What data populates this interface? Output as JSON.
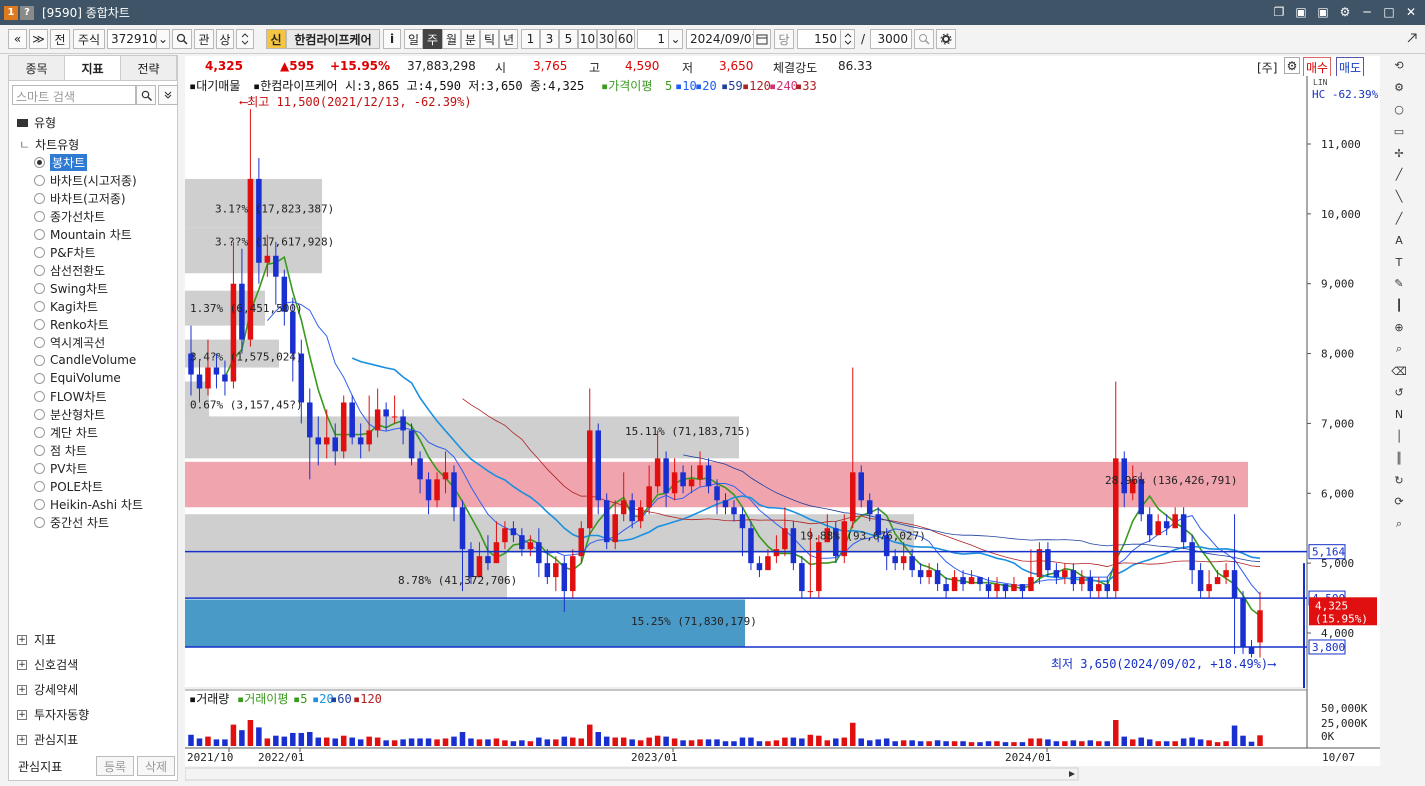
{
  "window": {
    "badges": [
      "1",
      "?"
    ],
    "title": "[9590] 종합차트",
    "controls": [
      "❐",
      "▣",
      "⚙",
      "─",
      "□",
      "✕"
    ]
  },
  "toolbar": {
    "nav_prev": "«",
    "nav_down": "≫",
    "jeon": "전",
    "market": "주식",
    "code": "372910",
    "dropdown": "⌄",
    "search_icon": "search-icon",
    "gwan": "관",
    "sang": "상",
    "shin": "신",
    "stock_name": "한컴라이프케어",
    "info": "i",
    "periods": [
      "일",
      "주",
      "월",
      "분",
      "틱",
      "년"
    ],
    "active_period": "주",
    "intervals": [
      "1",
      "3",
      "5",
      "10",
      "30",
      "60"
    ],
    "interval_value": "1",
    "date": "2024/09/07",
    "dang": "당",
    "count": "150",
    "slash": "/",
    "total": "3000"
  },
  "left": {
    "tabs": [
      "종목",
      "지표",
      "전략"
    ],
    "active_tab": "지표",
    "search_placeholder": "스마트 검색",
    "category": "유형",
    "group": "차트유형",
    "chart_types": [
      "봉차트",
      "바차트(시고저종)",
      "바차트(고저종)",
      "종가선차트",
      "Mountain 차트",
      "P&F차트",
      "삼선전환도",
      "Swing차트",
      "Kagi차트",
      "Renko차트",
      "역시계곡선",
      "CandleVolume",
      "EquiVolume",
      "FLOW차트",
      "분산형차트",
      "계단 차트",
      "점 차트",
      "PV차트",
      "POLE차트",
      "Heikin-Ashi 차트",
      "중간선 차트"
    ],
    "selected_type": "봉차트",
    "groups": [
      "지표",
      "신호검색",
      "강세약세",
      "투자자동향",
      "관심지표"
    ],
    "footer_label": "관심지표",
    "footer_register": "등록",
    "footer_delete": "삭제"
  },
  "quote": {
    "price": "4,325",
    "change": "▲595",
    "rate": "+15.95%",
    "volume": "37,883,298",
    "open_label": "시",
    "open": "3,765",
    "high_label": "고",
    "high": "4,590",
    "low_label": "저",
    "low": "3,650",
    "strength_label": "체결강도",
    "strength": "86.33",
    "mode": "[주]",
    "buy": "매수",
    "sell": "매도"
  },
  "legend": {
    "vp": "대기매물",
    "name": "한컴라이프케어",
    "ohlc": "시:3,865 고:4,590 저:3,650 종:4,325",
    "ma_label": "가격이평",
    "ma_periods": [
      "5",
      "10",
      "20",
      "59",
      "120",
      "240",
      "33"
    ],
    "ma_colors": [
      "#3a9a1e",
      "#1e5ef0",
      "#1e5ef0",
      "#1e3f9e",
      "#b02020",
      "#d03070",
      "#b02020"
    ],
    "hc": "HC -62.39%",
    "scale_tag": "LIN"
  },
  "annotations": {
    "high": "⟵최고 11,500(2021/12/13, -62.39%)",
    "low": "최저 3,650(2024/09/02, +18.49%)⟶"
  },
  "volume_profile": [
    {
      "label": "3.1?% (17,823,387)"
    },
    {
      "label": "3.??% (17,617,928)"
    },
    {
      "label": "1.37% (6,451,500)"
    },
    {
      "label": "3.4?% (1,575,024)"
    },
    {
      "label": "0.67% (3,157,45?)"
    },
    {
      "label": "15.11% (71,183,715)"
    },
    {
      "label": "28.96% (136,426,791)"
    },
    {
      "label": "19.88% (93,676,027)"
    },
    {
      "label": "8.78% (41,372,706)"
    },
    {
      "label": "15.25% (71,830,179)"
    }
  ],
  "hlines": [
    {
      "value": 5164,
      "label": "5,164"
    },
    {
      "value": 4500,
      "label": "4,500"
    },
    {
      "value": 3800,
      "label": "3,800"
    }
  ],
  "current_tag": {
    "price": "4,325",
    "rate": "(15.95%)"
  },
  "y_ticks": [
    "11,000",
    "10,000",
    "9,000",
    "8,000",
    "7,000",
    "6,000",
    "5,000",
    "4,000"
  ],
  "x_ticks": [
    "2021/10",
    "2022/01",
    "2023/01",
    "2024/01"
  ],
  "x_right_label": "10/07",
  "volume_legend": {
    "title": "거래량",
    "ma_label": "거래이평",
    "periods": [
      "5",
      "20",
      "60",
      "120"
    ]
  },
  "volume_ticks": [
    "50,000K",
    "25,000K",
    "0K"
  ],
  "chart_data": {
    "type": "candlestick",
    "y_range": [
      3000,
      12000
    ],
    "x_labels": [
      "2021/10",
      "2022/01",
      "2023/01",
      "2024/01"
    ],
    "candles": [
      [
        8000,
        7700,
        8400,
        7400
      ],
      [
        7700,
        7500,
        7900,
        7300
      ],
      [
        7500,
        7800,
        8200,
        7400
      ],
      [
        7800,
        7700,
        8000,
        7500
      ],
      [
        7700,
        7600,
        7900,
        7400
      ],
      [
        7600,
        9000,
        9600,
        7500
      ],
      [
        9000,
        8200,
        9500,
        8000
      ],
      [
        8200,
        10500,
        11500,
        8100
      ],
      [
        10500,
        9300,
        10800,
        9000
      ],
      [
        9300,
        9400,
        9700,
        9100
      ],
      [
        9400,
        9100,
        9600,
        8700
      ],
      [
        9100,
        8600,
        9200,
        8400
      ],
      [
        8600,
        8000,
        8800,
        7600
      ],
      [
        8000,
        7300,
        8200,
        7000
      ],
      [
        7300,
        6800,
        7500,
        6200
      ],
      [
        6800,
        6700,
        7100,
        6400
      ],
      [
        6700,
        6800,
        7200,
        6500
      ],
      [
        6800,
        6600,
        7000,
        6400
      ],
      [
        6600,
        7300,
        7400,
        6500
      ],
      [
        7300,
        6800,
        7400,
        6700
      ],
      [
        6800,
        6700,
        7000,
        6500
      ],
      [
        6700,
        6900,
        7400,
        6600
      ],
      [
        6900,
        7200,
        7500,
        6800
      ],
      [
        7200,
        7100,
        7300,
        6900
      ],
      [
        7100,
        7100,
        7400,
        7000
      ],
      [
        7100,
        6900,
        7200,
        6700
      ],
      [
        6900,
        6500,
        7000,
        6400
      ],
      [
        6500,
        6200,
        6600,
        6000
      ],
      [
        6200,
        5900,
        6300,
        5700
      ],
      [
        5900,
        6200,
        6300,
        5800
      ],
      [
        6200,
        6300,
        6600,
        6000
      ],
      [
        6300,
        5800,
        6400,
        5600
      ],
      [
        5800,
        5200,
        5900,
        4600
      ],
      [
        5200,
        4800,
        5300,
        4700
      ],
      [
        4800,
        5100,
        5300,
        4800
      ],
      [
        5100,
        5000,
        5400,
        4900
      ],
      [
        5000,
        5300,
        5600,
        5000
      ],
      [
        5300,
        5500,
        5600,
        5200
      ],
      [
        5500,
        5400,
        5600,
        5300
      ],
      [
        5400,
        5200,
        5500,
        5100
      ],
      [
        5200,
        5300,
        5400,
        5100
      ],
      [
        5300,
        5000,
        5500,
        4800
      ],
      [
        5000,
        4800,
        5200,
        4700
      ],
      [
        4800,
        5000,
        5100,
        4600
      ],
      [
        5000,
        4600,
        5100,
        4300
      ],
      [
        4600,
        5100,
        5200,
        4500
      ],
      [
        5100,
        5500,
        5600,
        5000
      ],
      [
        5500,
        6900,
        7500,
        5400
      ],
      [
        6900,
        5900,
        7000,
        5700
      ],
      [
        5900,
        5300,
        6000,
        5200
      ],
      [
        5300,
        5700,
        5900,
        5200
      ],
      [
        5700,
        5900,
        6300,
        5600
      ],
      [
        5900,
        5600,
        6000,
        5500
      ],
      [
        5600,
        5800,
        5900,
        5500
      ],
      [
        5800,
        6100,
        6400,
        5700
      ],
      [
        6100,
        6500,
        6900,
        6000
      ],
      [
        6500,
        6000,
        6600,
        5800
      ],
      [
        6000,
        6300,
        6500,
        5900
      ],
      [
        6300,
        6100,
        6400,
        6000
      ],
      [
        6100,
        6200,
        6400,
        6000
      ],
      [
        6200,
        6400,
        6600,
        6100
      ],
      [
        6400,
        6100,
        6500,
        6000
      ],
      [
        6100,
        5900,
        6200,
        5700
      ],
      [
        5900,
        5800,
        6000,
        5700
      ],
      [
        5800,
        5700,
        5900,
        5600
      ],
      [
        5700,
        5500,
        5800,
        5100
      ],
      [
        5500,
        5000,
        5600,
        4900
      ],
      [
        5000,
        4900,
        5100,
        4800
      ],
      [
        4900,
        5100,
        5200,
        4900
      ],
      [
        5100,
        5200,
        5400,
        5000
      ],
      [
        5200,
        5500,
        5800,
        5100
      ],
      [
        5500,
        5000,
        5600,
        4900
      ],
      [
        5000,
        4600,
        5100,
        4500
      ],
      [
        4600,
        4600,
        5500,
        4500
      ],
      [
        4600,
        5300,
        5400,
        4500
      ],
      [
        5300,
        5500,
        5700,
        5300
      ],
      [
        5500,
        5100,
        5600,
        5000
      ],
      [
        5100,
        5600,
        5700,
        5000
      ],
      [
        5600,
        6300,
        7800,
        5500
      ],
      [
        6300,
        5900,
        6400,
        5800
      ],
      [
        5900,
        5700,
        6000,
        5600
      ],
      [
        5700,
        5400,
        5800,
        5300
      ],
      [
        5400,
        5100,
        5500,
        4900
      ],
      [
        5100,
        5000,
        5200,
        4900
      ],
      [
        5000,
        5100,
        5300,
        4900
      ],
      [
        5100,
        4900,
        5200,
        4800
      ],
      [
        4900,
        4800,
        5000,
        4700
      ],
      [
        4800,
        4900,
        5000,
        4700
      ],
      [
        4900,
        4700,
        5000,
        4600
      ],
      [
        4700,
        4600,
        4800,
        4500
      ],
      [
        4600,
        4800,
        4900,
        4600
      ],
      [
        4800,
        4700,
        4900,
        4600
      ],
      [
        4700,
        4800,
        4900,
        4700
      ],
      [
        4800,
        4700,
        4800,
        4600
      ],
      [
        4700,
        4600,
        4800,
        4500
      ],
      [
        4600,
        4700,
        4800,
        4500
      ],
      [
        4700,
        4600,
        4700,
        4500
      ],
      [
        4600,
        4700,
        4800,
        4600
      ],
      [
        4700,
        4600,
        4700,
        4500
      ],
      [
        4600,
        4800,
        5200,
        4600
      ],
      [
        4800,
        5200,
        5300,
        4700
      ],
      [
        5200,
        4900,
        5300,
        4800
      ],
      [
        4900,
        4800,
        5000,
        4700
      ],
      [
        4800,
        4900,
        5000,
        4700
      ],
      [
        4900,
        4700,
        5000,
        4600
      ],
      [
        4700,
        4800,
        4900,
        4600
      ],
      [
        4800,
        4600,
        4900,
        4500
      ],
      [
        4600,
        4700,
        4800,
        4500
      ],
      [
        4700,
        4600,
        4800,
        4500
      ],
      [
        4600,
        6500,
        7600,
        4500
      ],
      [
        6500,
        6000,
        6600,
        5800
      ],
      [
        6000,
        6200,
        6400,
        5900
      ],
      [
        6200,
        5700,
        6300,
        5600
      ],
      [
        5700,
        5400,
        5800,
        5300
      ],
      [
        5400,
        5600,
        5700,
        5400
      ],
      [
        5600,
        5500,
        5700,
        5400
      ],
      [
        5500,
        5700,
        5800,
        5500
      ],
      [
        5700,
        5300,
        5800,
        5200
      ],
      [
        5300,
        4900,
        5400,
        4700
      ],
      [
        4900,
        4600,
        5000,
        4500
      ],
      [
        4600,
        4700,
        4900,
        4500
      ],
      [
        4700,
        4800,
        4900,
        4700
      ],
      [
        4800,
        4900,
        5000,
        4700
      ],
      [
        4900,
        4500,
        5700,
        3700
      ],
      [
        4500,
        3800,
        4600,
        3700
      ],
      [
        3800,
        3700,
        3900,
        3650
      ],
      [
        3865,
        4325,
        4590,
        3650
      ]
    ]
  }
}
